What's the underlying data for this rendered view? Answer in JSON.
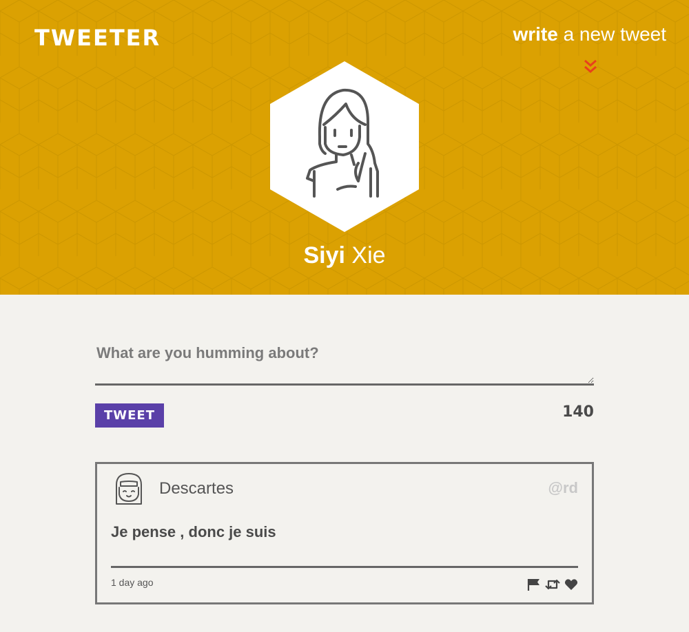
{
  "header": {
    "brand": "TWEETER",
    "compose_link": {
      "bold": "write",
      "rest": "a new tweet"
    },
    "accent_color": "#dba102",
    "chevron_color": "#e8401c",
    "user": {
      "first_name": "Siyi",
      "last_name": "Xie"
    }
  },
  "composer": {
    "placeholder": "What are you humming about?",
    "value": "",
    "submit_label": "TWEET",
    "submit_color": "#5a40a8",
    "char_count": "140"
  },
  "tweets": [
    {
      "author": "Descartes",
      "handle": "@rd",
      "content": "Je pense , donc je suis",
      "time": "1 day ago",
      "actions": [
        "flag-icon",
        "retweet-icon",
        "heart-icon"
      ]
    }
  ]
}
